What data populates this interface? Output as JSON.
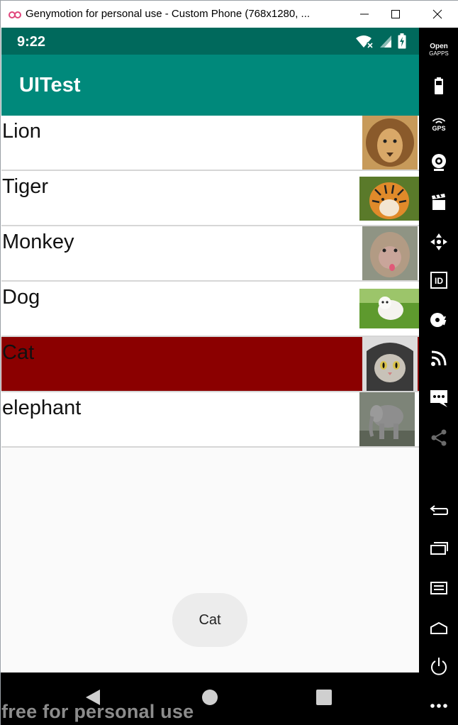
{
  "window": {
    "title": "Genymotion for personal use - Custom Phone (768x1280, ..."
  },
  "status_bar": {
    "time": "9:22"
  },
  "app_bar": {
    "title": "UITest"
  },
  "list": {
    "items": [
      {
        "label": "Lion",
        "selected": false
      },
      {
        "label": "Tiger",
        "selected": false
      },
      {
        "label": "Monkey",
        "selected": false
      },
      {
        "label": "Dog",
        "selected": false
      },
      {
        "label": "Cat",
        "selected": true
      },
      {
        "label": "elephant",
        "selected": false
      }
    ]
  },
  "toast": {
    "text": "Cat"
  },
  "side_panel": {
    "gapps_label_1": "Open",
    "gapps_label_2": "GAPPS",
    "gps_label": "GPS",
    "id_label": "ID"
  },
  "watermark": "free for personal use",
  "colors": {
    "status_bar": "#00695c",
    "app_bar": "#00897b",
    "selected_row": "#8b0000"
  }
}
